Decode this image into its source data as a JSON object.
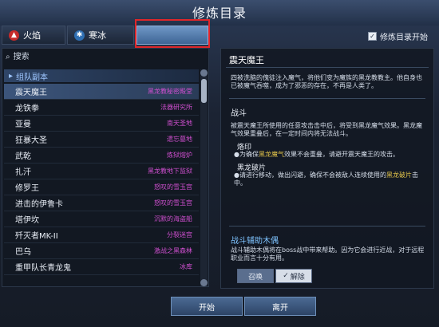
{
  "window": {
    "title": "修炼目录"
  },
  "tabs": [
    {
      "label": "火焰",
      "icon": "fire-icon"
    },
    {
      "label": "寒冰",
      "icon": "snowflake-icon"
    },
    {
      "label": ""
    }
  ],
  "option": {
    "label": "修炼目录开始",
    "checked": true
  },
  "search": {
    "label": "搜索",
    "icon": "search-icon"
  },
  "list": {
    "group": "组队副本",
    "rows": [
      {
        "name": "震天魔王",
        "location": "黑龙教秘密殿堂",
        "selected": true
      },
      {
        "name": "龙铁拳",
        "location": "法器研究所"
      },
      {
        "name": "亚曼",
        "location": "南天圣地"
      },
      {
        "name": "狂暴大圣",
        "location": "遗忘墓地"
      },
      {
        "name": "武乾",
        "location": "炼狱熔炉"
      },
      {
        "name": "扎汗",
        "location": "黑龙教地下监狱"
      },
      {
        "name": "修罗王",
        "location": "怒叹的雪玉宫"
      },
      {
        "name": "进击的伊鲁卡",
        "location": "怒叹的雪玉宫"
      },
      {
        "name": "塔伊坎",
        "location": "沉默的海盗船"
      },
      {
        "name": "歼灭者MK-II",
        "location": "分裂迷宫"
      },
      {
        "name": "巴乌",
        "location": "激战之黑森林"
      },
      {
        "name": "重甲队长青龙鬼",
        "location": "冰库"
      }
    ]
  },
  "detail": {
    "title": "震天魔王",
    "description": "四被洗脑的傀徒注入魔气，将他们变为魔族的黑龙教教主。他自身也已被魔气吞噬，成为了邪恶的存在，不再是人类了。",
    "battle_heading": "战斗",
    "battle_text": "被震天魔王所使用的任意攻击击中后，将受到黑龙魔气效果。黑龙魔气效果重叠后，在一定时间内将无法战斗。",
    "mech1_name": "烙印",
    "mech1_pre": "为确保",
    "mech1_hl": "黑龙魔气",
    "mech1_post": "效果不会重叠，请避开震天魔王的攻击。",
    "mech2_name": "黑龙破片",
    "mech2_pre": "请进行移动，做出闪避，确保不会被敌人连续使用的",
    "mech2_hl": "黑龙破片",
    "mech2_post": "击中。",
    "helper_heading": "战斗辅助木偶",
    "helper_text": "战斗辅助木偶将在boss战中带来帮助。因为它会进行近战，对于远程职业而言十分有用。",
    "toggle_summon": "召唤",
    "toggle_release": "解除"
  },
  "buttons": {
    "start": "开始",
    "leave": "离开"
  }
}
